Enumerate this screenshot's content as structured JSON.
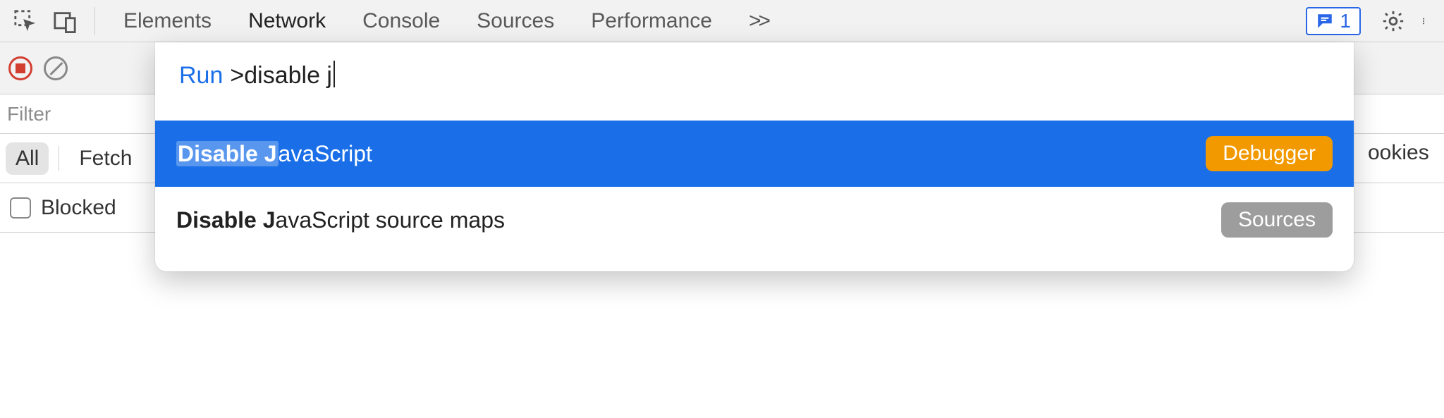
{
  "tabs": {
    "items": [
      "Elements",
      "Network",
      "Console",
      "Sources",
      "Performance"
    ],
    "active_index": 1,
    "overflow_glyph": ">>"
  },
  "issues": {
    "count": "1"
  },
  "filter": {
    "placeholder": "Filter"
  },
  "resource_filters": {
    "all": "All",
    "fetch_partial": "Fetch"
  },
  "blocked": {
    "label": "Blocked"
  },
  "peek": {
    "cookies": "ookies"
  },
  "palette": {
    "prefix": "Run",
    "query_prompt": ">",
    "query_text": "disable j",
    "results": [
      {
        "match_prefix": "Disable J",
        "rest": "avaScript",
        "badge": "Debugger",
        "selected": true
      },
      {
        "match_prefix": "Disable J",
        "rest": "avaScript source maps",
        "badge": "Sources",
        "selected": false
      }
    ]
  }
}
